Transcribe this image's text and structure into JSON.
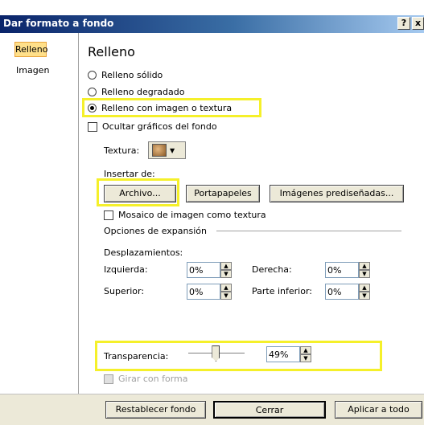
{
  "window": {
    "title": "Dar formato a fondo",
    "help_label": "?",
    "close_label": "x"
  },
  "nav": {
    "items": [
      {
        "label": "Relleno"
      },
      {
        "label": "Imagen"
      }
    ]
  },
  "panel": {
    "section_title": "Relleno",
    "radios": [
      {
        "label": "Relleno sólido",
        "selected": false
      },
      {
        "label": "Relleno degradado",
        "selected": false
      },
      {
        "label": "Relleno con imagen o textura",
        "selected": true
      }
    ],
    "hide_graphics_label": "Ocultar gráficos del fondo",
    "texture_label": "Textura:",
    "insert_from_label": "Insertar de:",
    "buttons": {
      "file": "Archivo...",
      "clipboard": "Portapapeles",
      "clipart": "Imágenes prediseñadas..."
    },
    "tile_label": "Mosaico de imagen como textura",
    "expansion_label": "Opciones de expansión",
    "offsets_label": "Desplazamientos:",
    "offsets": {
      "left": {
        "label": "Izquierda:",
        "value": "0%"
      },
      "right": {
        "label": "Derecha:",
        "value": "0%"
      },
      "top": {
        "label": "Superior:",
        "value": "0%"
      },
      "bottom": {
        "label": "Parte inferior:",
        "value": "0%"
      }
    },
    "transparency": {
      "label": "Transparencia:",
      "value": "49%",
      "level": 0.49
    },
    "rotate_label": "Girar con forma"
  },
  "footer": {
    "reset": "Restablecer fondo",
    "close": "Cerrar",
    "apply_all": "Aplicar a todo"
  },
  "colors": {
    "highlight": "#f5f02a",
    "title_bar": "#0a246a",
    "selected_tab": "#ffe08a"
  }
}
